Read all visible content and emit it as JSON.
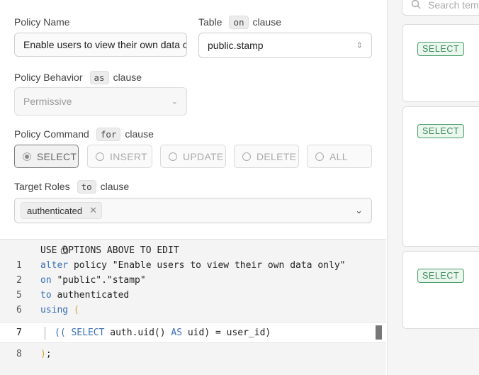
{
  "form": {
    "policy_name": {
      "label": "Policy Name",
      "value": "Enable users to view their own data only"
    },
    "table": {
      "label": "Table",
      "keyword": "on",
      "suffix": "clause",
      "value": "public.stamp"
    },
    "behavior": {
      "label": "Policy Behavior",
      "keyword": "as",
      "suffix": "clause",
      "value": "Permissive"
    },
    "command": {
      "label": "Policy Command",
      "keyword": "for",
      "suffix": "clause",
      "options": [
        "SELECT",
        "INSERT",
        "UPDATE",
        "DELETE",
        "ALL"
      ],
      "selected": "SELECT"
    },
    "roles": {
      "label": "Target Roles",
      "keyword": "to",
      "suffix": "clause",
      "chip": "authenticated"
    }
  },
  "editor": {
    "notice": "USE OPTIONS ABOVE TO EDIT",
    "lines": [
      {
        "no": "1",
        "a": "alter",
        "b": " policy \"Enable users to view their own data only\""
      },
      {
        "no": "2",
        "a": "on",
        "b": " \"public\".\"stamp\""
      },
      {
        "no": "5",
        "a": "to",
        "b": " authenticated"
      },
      {
        "no": "6",
        "a": "using",
        "b": " ("
      },
      {
        "no": "7",
        "p1": "((",
        "kw1": "SELECT",
        "mid": " auth.uid() ",
        "kw2": "AS",
        "end": " uid) = user_id)"
      },
      {
        "no": "8",
        "text": ");"
      }
    ]
  },
  "sidebar": {
    "search_placeholder": "Search templates",
    "badges": [
      "SELECT",
      "SELECT",
      "SELECT"
    ]
  },
  "colors": {
    "badge_green": "#3a8a5a",
    "keyword_blue": "#3b6fb6",
    "paren_amber": "#d1a13a"
  }
}
